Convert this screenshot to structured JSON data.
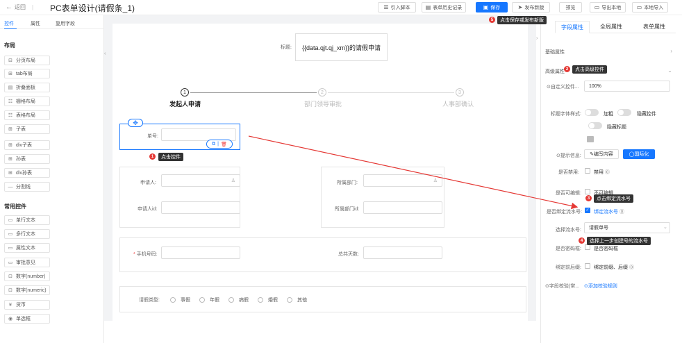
{
  "header": {
    "back_label": "返回",
    "title": "PC表单设计(请假条_1)",
    "buttons": {
      "import_script": "引入脚本",
      "history": "表单历史记录",
      "save": "保存",
      "publish": "发布新版",
      "preview": "预览",
      "export_local": "导出本地",
      "import_local": "本地导入"
    }
  },
  "left": {
    "tabs": [
      "控件",
      "属性",
      "复用字段"
    ],
    "layout_title": "布局",
    "layout_items": [
      "分页布局",
      "tab布局",
      "折叠面板",
      "栅格布局",
      "表格布局",
      "子表",
      "div子表",
      "孙表",
      "div孙表",
      "分割线"
    ],
    "common_title": "常用控件",
    "common_items": [
      "单行文本",
      "多行文本",
      "属性文本",
      "审批意见",
      "数字(number)",
      "数字(numeric)",
      "货币",
      "单选框"
    ]
  },
  "form": {
    "title_label": "标题:",
    "title_value": "{{data.qjt.qj_xm}}的请假申请",
    "steps": [
      {
        "index": "1",
        "label": "发起人申请"
      },
      {
        "index": "2",
        "label": "部门领导审批"
      },
      {
        "index": "3",
        "label": "人事部确认"
      }
    ],
    "serial_label": "单号:",
    "applicant_label": "申请人:",
    "applicant_id_label": "申请人id:",
    "dept_label": "所属部门:",
    "dept_id_label": "所属部门id:",
    "phone_label": "手机号码:",
    "days_label": "总共天数:",
    "leave_type_label": "请假类型:",
    "leave_types": [
      "事假",
      "年假",
      "病假",
      "婚假",
      "其他"
    ]
  },
  "right": {
    "tabs": [
      "字段属性",
      "全局属性",
      "表单属性"
    ],
    "basic_section": "基础属性",
    "advanced_section": "高级属性",
    "custom_control_label": "⊙自定义控件...",
    "custom_control_value": "100%",
    "title_style_label": "标题字体样式:",
    "bold_label": "加粗",
    "hide_control_label": "隐藏控件",
    "hide_title_label": "隐藏标题",
    "hint_label": "⊙提示信息:",
    "edit_content_label": "编写内容",
    "i18n_label": "国际化",
    "disabled_label": "是否禁用:",
    "disabled_text": "禁用",
    "editable_label": "是否可编辑:",
    "editable_text": "不可编辑",
    "bind_serial_label": "是否绑定流水号:",
    "bind_serial_text": "绑定流水号",
    "choose_serial_label": "选择流水号:",
    "choose_serial_value": "请假单号",
    "password_label": "是否密码框:",
    "password_text": "是否密码框",
    "bind_prefix_label": "绑定前后缀:",
    "bind_prefix_text": "绑定前缀、后缀",
    "validate_label": "⊙字段校验(常...",
    "validate_link": "添加校验规则"
  },
  "annotations": [
    {
      "num": "1",
      "text": "点击控件"
    },
    {
      "num": "2",
      "text": "点击高级控件"
    },
    {
      "num": "3",
      "text": "点击绑定流水号"
    },
    {
      "num": "4",
      "text": "选择上一步创建号的流水号"
    },
    {
      "num": "5",
      "text": "点击保存或发布新版"
    }
  ],
  "colors": {
    "primary": "#1677ff",
    "annotation": "#e53935",
    "tooltip": "#333333"
  }
}
